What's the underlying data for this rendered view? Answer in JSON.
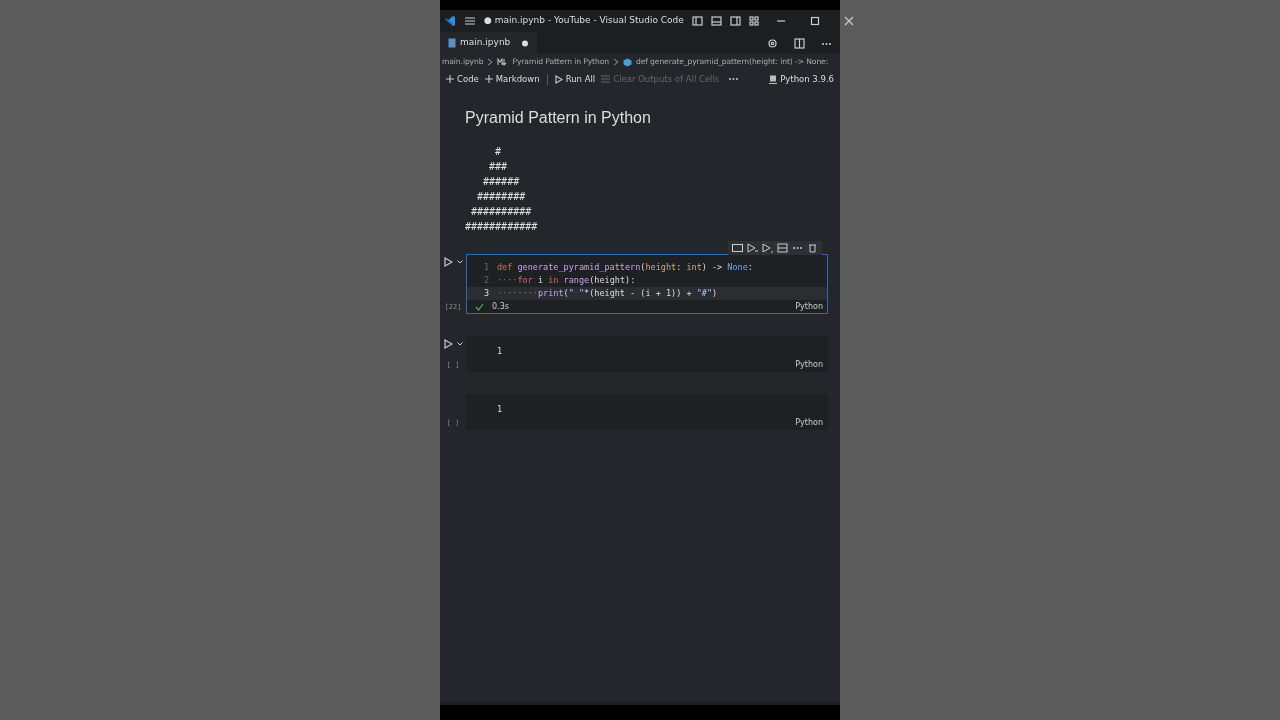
{
  "window": {
    "title": "● main.ipynb - YouTube - Visual Studio Code"
  },
  "tabs": [
    {
      "label": "main.ipynb",
      "selected": true,
      "modified": true
    }
  ],
  "breadcrumbs": [
    {
      "label": "main.ipynb",
      "kind": "file"
    },
    {
      "label": "Pyramid Pattern in Python",
      "kind": "markdown"
    },
    {
      "label": "def generate_pyramid_pattern(height: int) -> None:",
      "kind": "symbol"
    }
  ],
  "toolbar": {
    "items": [
      {
        "label": "Code",
        "kind": "add",
        "disabled": false
      },
      {
        "label": "Markdown",
        "kind": "add",
        "disabled": false
      },
      {
        "label": "Run All",
        "kind": "run",
        "disabled": false
      },
      {
        "label": "Clear Outputs of All Cells",
        "kind": "clear",
        "disabled": true
      }
    ],
    "kernel": "Python 3.9.6"
  },
  "markdown": {
    "heading": "Pyramid Pattern in Python",
    "pattern": [
      "     #",
      "    ###",
      "   ######",
      "  ########",
      " ##########",
      "############"
    ]
  },
  "cells": [
    {
      "selected": true,
      "run_button": true,
      "count": "[22]",
      "status": "0.3s",
      "success": true,
      "language": "Python",
      "lines": [
        {
          "number": "1",
          "current": false,
          "tokens": [
            {
              "text": "def ",
              "kind": "keyword"
            },
            {
              "text": "generate_pyramid_pattern",
              "kind": "function"
            },
            {
              "text": "(",
              "kind": "plain"
            },
            {
              "text": "height",
              "kind": "param"
            },
            {
              "text": ": ",
              "kind": "plain"
            },
            {
              "text": "int",
              "kind": "type"
            },
            {
              "text": ") -> ",
              "kind": "plain"
            },
            {
              "text": "None",
              "kind": "constant"
            },
            {
              "text": ":",
              "kind": "plain"
            }
          ]
        },
        {
          "number": "2",
          "current": false,
          "tokens": [
            {
              "text": "····",
              "kind": "whitespace"
            },
            {
              "text": "for ",
              "kind": "keyword"
            },
            {
              "text": "i ",
              "kind": "variable"
            },
            {
              "text": "in ",
              "kind": "keyword"
            },
            {
              "text": "range",
              "kind": "function"
            },
            {
              "text": "(",
              "kind": "plain"
            },
            {
              "text": "height",
              "kind": "variable"
            },
            {
              "text": "):",
              "kind": "plain"
            }
          ]
        },
        {
          "number": "3",
          "current": true,
          "tokens": [
            {
              "text": "········",
              "kind": "whitespace"
            },
            {
              "text": "print",
              "kind": "function"
            },
            {
              "text": "(",
              "kind": "plain"
            },
            {
              "text": "\" \"",
              "kind": "string"
            },
            {
              "text": "*(",
              "kind": "plain"
            },
            {
              "text": "height",
              "kind": "variable"
            },
            {
              "text": " - (",
              "kind": "plain"
            },
            {
              "text": "i",
              "kind": "variable"
            },
            {
              "text": " + ",
              "kind": "plain"
            },
            {
              "text": "1",
              "kind": "number"
            },
            {
              "text": ")) + ",
              "kind": "plain"
            },
            {
              "text": "\"#\"",
              "kind": "string"
            },
            {
              "text": ")",
              "kind": "plain"
            }
          ]
        }
      ]
    },
    {
      "selected": false,
      "run_button": true,
      "count": "[ ]",
      "language": "Python",
      "lines": [
        {
          "current": false,
          "tokens": [
            {
              "text": "1",
              "kind": "number"
            }
          ]
        }
      ]
    },
    {
      "selected": false,
      "run_button": false,
      "count": "[ ]",
      "language": "Python",
      "lines": [
        {
          "current": false,
          "tokens": [
            {
              "text": "1",
              "kind": "number"
            }
          ]
        }
      ]
    }
  ]
}
